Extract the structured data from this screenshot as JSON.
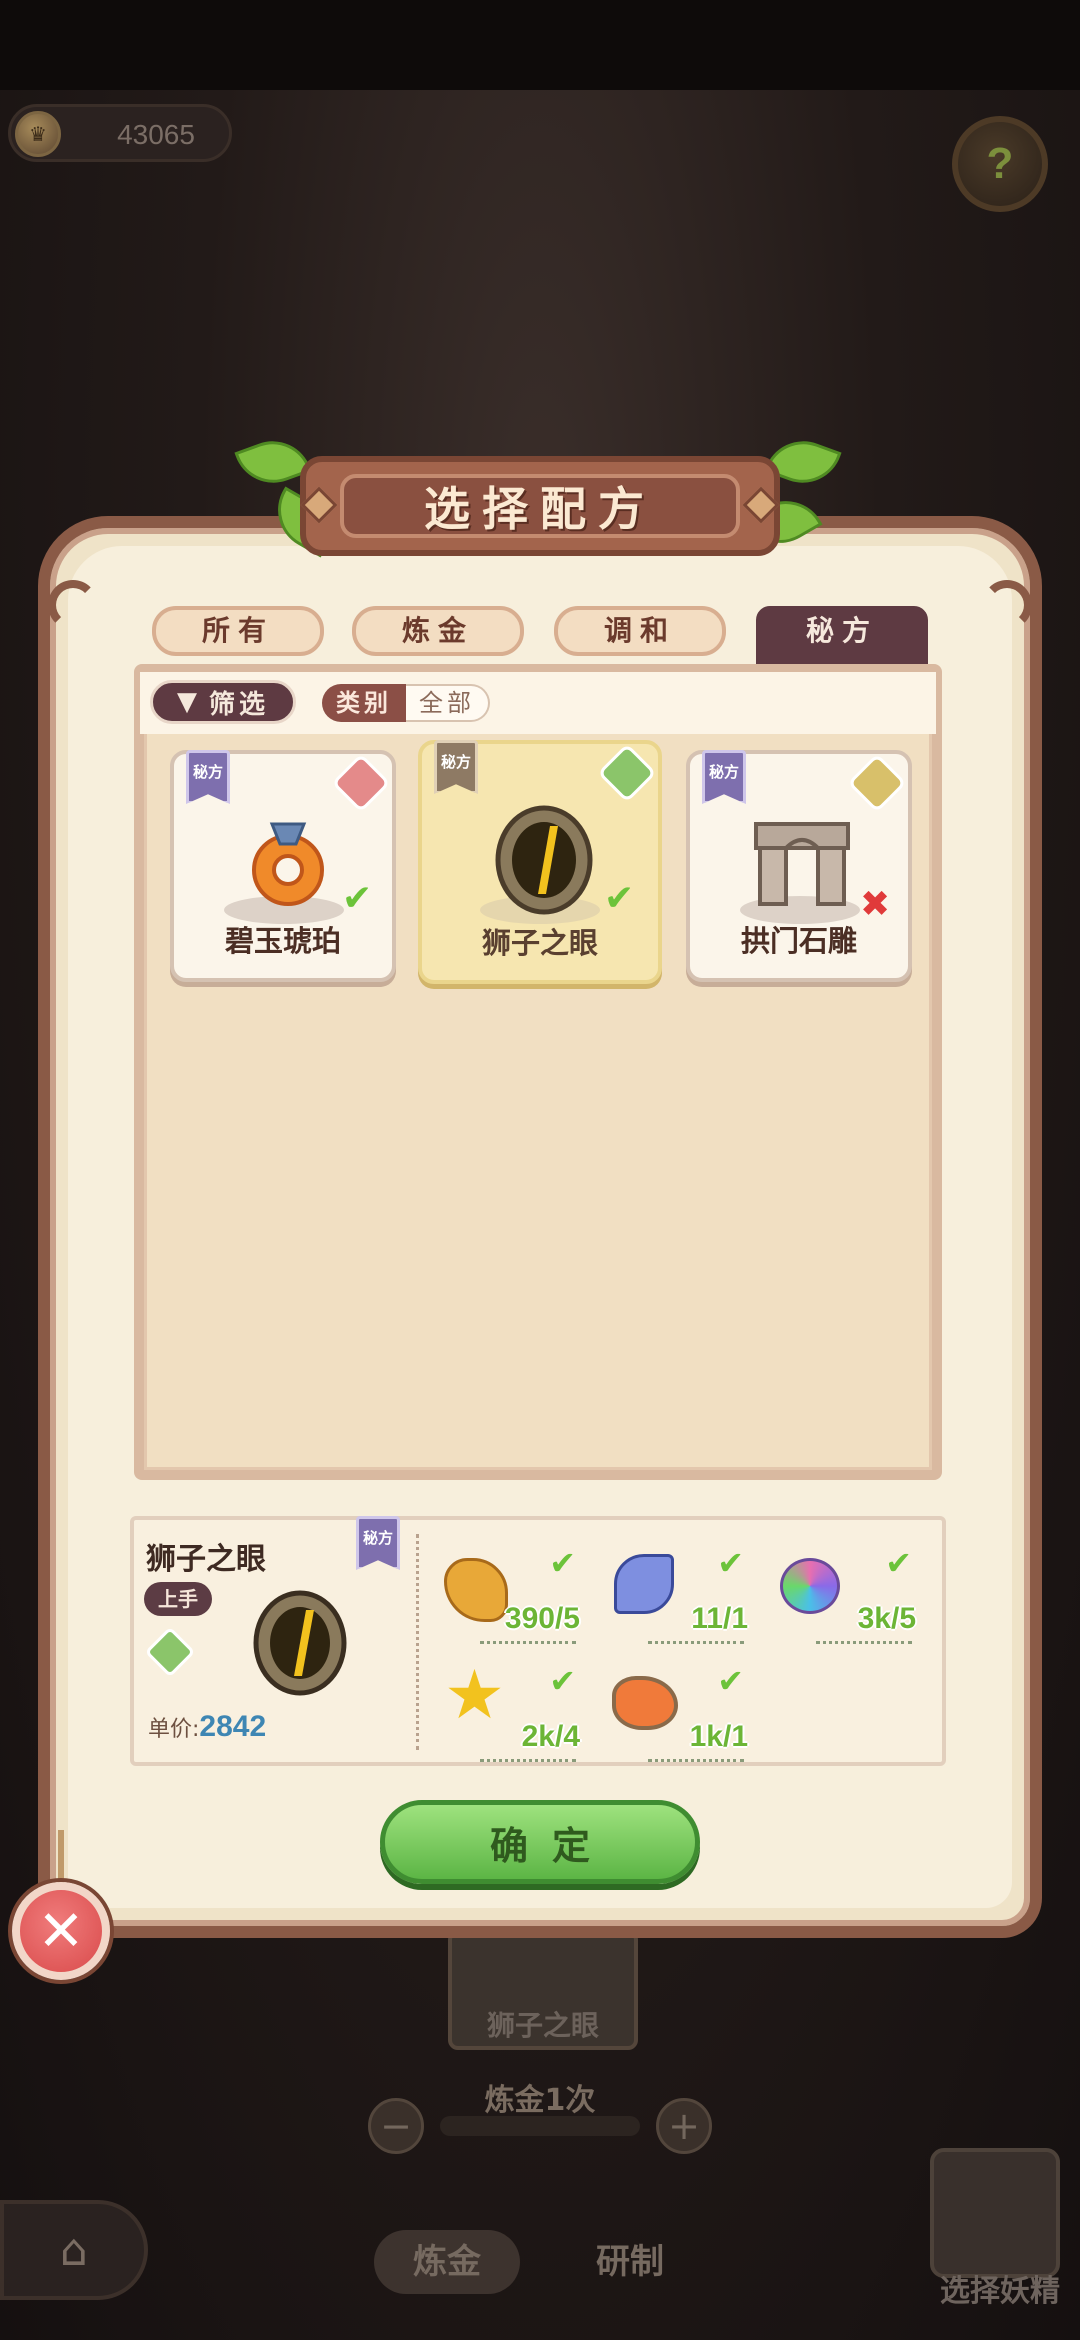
{
  "top_bar": {
    "coin_value": "43065",
    "coin_icon": "crown-coin-icon",
    "help_icon": "question-mark-icon"
  },
  "dialog": {
    "title": "选择配方",
    "tabs": [
      {
        "label": "所有",
        "active": false
      },
      {
        "label": "炼金",
        "active": false
      },
      {
        "label": "调和",
        "active": false
      },
      {
        "label": "秘方",
        "active": true
      }
    ],
    "filter": {
      "button_label": "筛选",
      "category_label": "类别",
      "category_value": "全部"
    },
    "recipes": [
      {
        "name": "碧玉琥珀",
        "badge": "秘方",
        "status": "available",
        "selected": false,
        "tag_color": "#e48a8a"
      },
      {
        "name": "狮子之眼",
        "badge": "秘方",
        "status": "available",
        "selected": true,
        "tag_color": "#8bc56a"
      },
      {
        "name": "拱门石雕",
        "badge": "秘方",
        "status": "unavailable",
        "selected": false,
        "tag_color": "#d8c06a"
      }
    ],
    "detail": {
      "name": "狮子之眼",
      "badge": "秘方",
      "skill_tag": "上手",
      "price_label": "单价:",
      "price_value": "2842",
      "ingredients": [
        {
          "icon": "wheat-icon",
          "qty": "390/5"
        },
        {
          "icon": "pinwheel-flower-icon",
          "qty": "11/1"
        },
        {
          "icon": "rainbow-feather-icon",
          "qty": "3k/5"
        },
        {
          "icon": "star-icon",
          "qty": "2k/4"
        },
        {
          "icon": "amber-stone-icon",
          "qty": "1k/1"
        }
      ]
    },
    "confirm_label": "确定",
    "close_icon": "close-x-icon"
  },
  "background": {
    "card_label": "狮子之眼",
    "craft_count": "炼金1次",
    "tab_alchemy": "炼金",
    "tab_research": "研制",
    "fairy_label": "选择妖精"
  },
  "colors": {
    "panel_border": "#8a5a46",
    "active_tab": "#5e3a42",
    "confirm_green": "#5cb545",
    "check_green": "#6cc33a",
    "cross_red": "#e03a3a",
    "price_blue": "#3e86b3"
  }
}
